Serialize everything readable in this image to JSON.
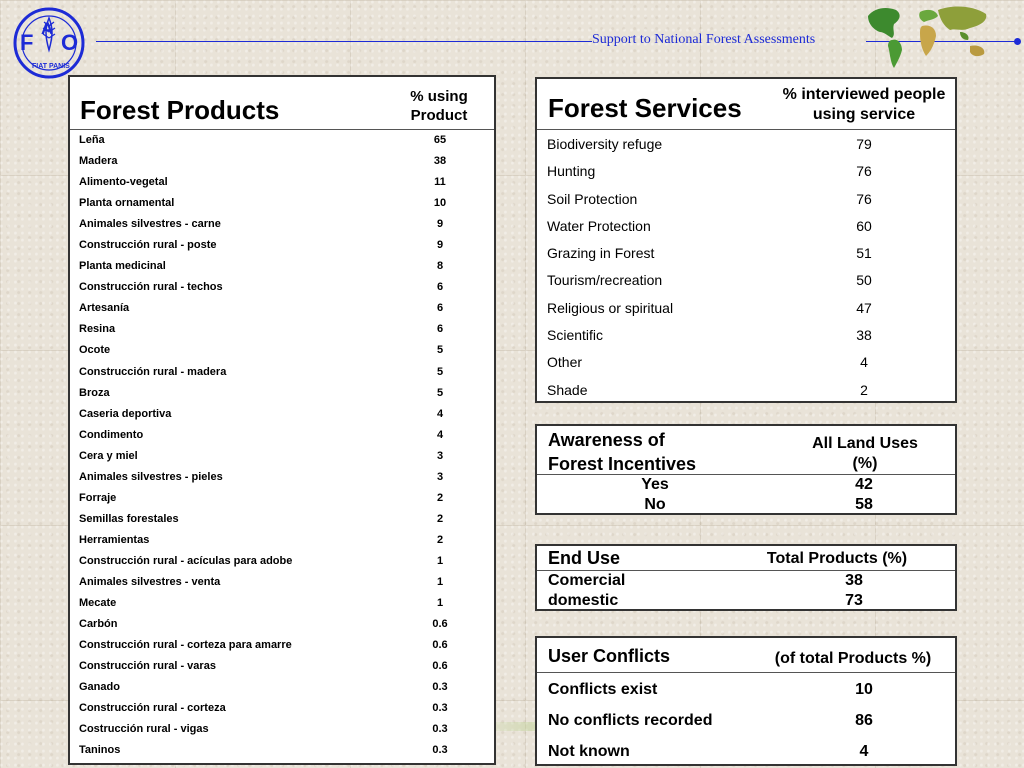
{
  "header": {
    "subtitle": "Support to National Forest Assessments",
    "logo_letters": "FAO",
    "logo_motto": "FIAT PANIS"
  },
  "colors": {
    "accent_blue": "#1d2bd6",
    "green_bar": "#aac27a"
  },
  "products": {
    "title": "Forest Products",
    "column_header": "% using Product",
    "rows": [
      {
        "name": "Leña",
        "value": "65"
      },
      {
        "name": "Madera",
        "value": "38"
      },
      {
        "name": "Alimento-vegetal",
        "value": "11"
      },
      {
        "name": "Planta ornamental",
        "value": "10"
      },
      {
        "name": "Animales silvestres - carne",
        "value": "9"
      },
      {
        "name": "Construcción rural - poste",
        "value": "9"
      },
      {
        "name": "Planta medicinal",
        "value": "8"
      },
      {
        "name": "Construcción rural - techos",
        "value": "6"
      },
      {
        "name": "Artesanía",
        "value": "6"
      },
      {
        "name": "Resina",
        "value": "6"
      },
      {
        "name": "Ocote",
        "value": "5"
      },
      {
        "name": "Construcción rural - madera",
        "value": "5"
      },
      {
        "name": "Broza",
        "value": "5"
      },
      {
        "name": "Caseria deportiva",
        "value": "4"
      },
      {
        "name": "Condimento",
        "value": "4"
      },
      {
        "name": "Cera y miel",
        "value": "3"
      },
      {
        "name": "Animales silvestres - pieles",
        "value": "3"
      },
      {
        "name": "Forraje",
        "value": "2"
      },
      {
        "name": "Semillas forestales",
        "value": "2"
      },
      {
        "name": "Herramientas",
        "value": "2"
      },
      {
        "name": "Construcción rural - acículas para adobe",
        "value": "1"
      },
      {
        "name": "Animales silvestres - venta",
        "value": "1"
      },
      {
        "name": "Mecate",
        "value": "1"
      },
      {
        "name": "Carbón",
        "value": "0.6"
      },
      {
        "name": "Construcción rural - corteza para amarre",
        "value": "0.6"
      },
      {
        "name": "Construcción rural - varas",
        "value": "0.6"
      },
      {
        "name": "Ganado",
        "value": "0.3"
      },
      {
        "name": "Construcción rural - corteza",
        "value": "0.3"
      },
      {
        "name": "Costrucción rural - vigas",
        "value": "0.3"
      },
      {
        "name": "Taninos",
        "value": "0.3"
      }
    ]
  },
  "services": {
    "title": "Forest Services",
    "column_header": "% interviewed people using service",
    "rows": [
      {
        "name": "Biodiversity refuge",
        "value": "79"
      },
      {
        "name": "Hunting",
        "value": "76"
      },
      {
        "name": "Soil Protection",
        "value": "76"
      },
      {
        "name": "Water Protection",
        "value": "60"
      },
      {
        "name": "Grazing in Forest",
        "value": "51"
      },
      {
        "name": "Tourism/recreation",
        "value": "50"
      },
      {
        "name": "Religious or spiritual",
        "value": "47"
      },
      {
        "name": "Scientific",
        "value": "38"
      },
      {
        "name": "Other",
        "value": "4"
      },
      {
        "name": "Shade",
        "value": "2"
      }
    ]
  },
  "awareness": {
    "title_line1": "Awareness of",
    "title_line2": "Forest Incentives",
    "column_header_line1": "All Land Uses",
    "column_header_line2": "(%)",
    "rows": [
      {
        "name": "Yes",
        "value": "42"
      },
      {
        "name": "No",
        "value": "58"
      }
    ]
  },
  "end_use": {
    "title": "End Use",
    "column_header": "Total Products (%)",
    "rows": [
      {
        "name": "Comercial",
        "value": "38"
      },
      {
        "name": "domestic",
        "value": "73"
      }
    ]
  },
  "conflicts": {
    "title": "User Conflicts",
    "column_header": "(of total Products %)",
    "rows": [
      {
        "name": "Conflicts exist",
        "value": "10"
      },
      {
        "name": "No conflicts recorded",
        "value": "86"
      },
      {
        "name": "Not known",
        "value": "4"
      }
    ]
  }
}
